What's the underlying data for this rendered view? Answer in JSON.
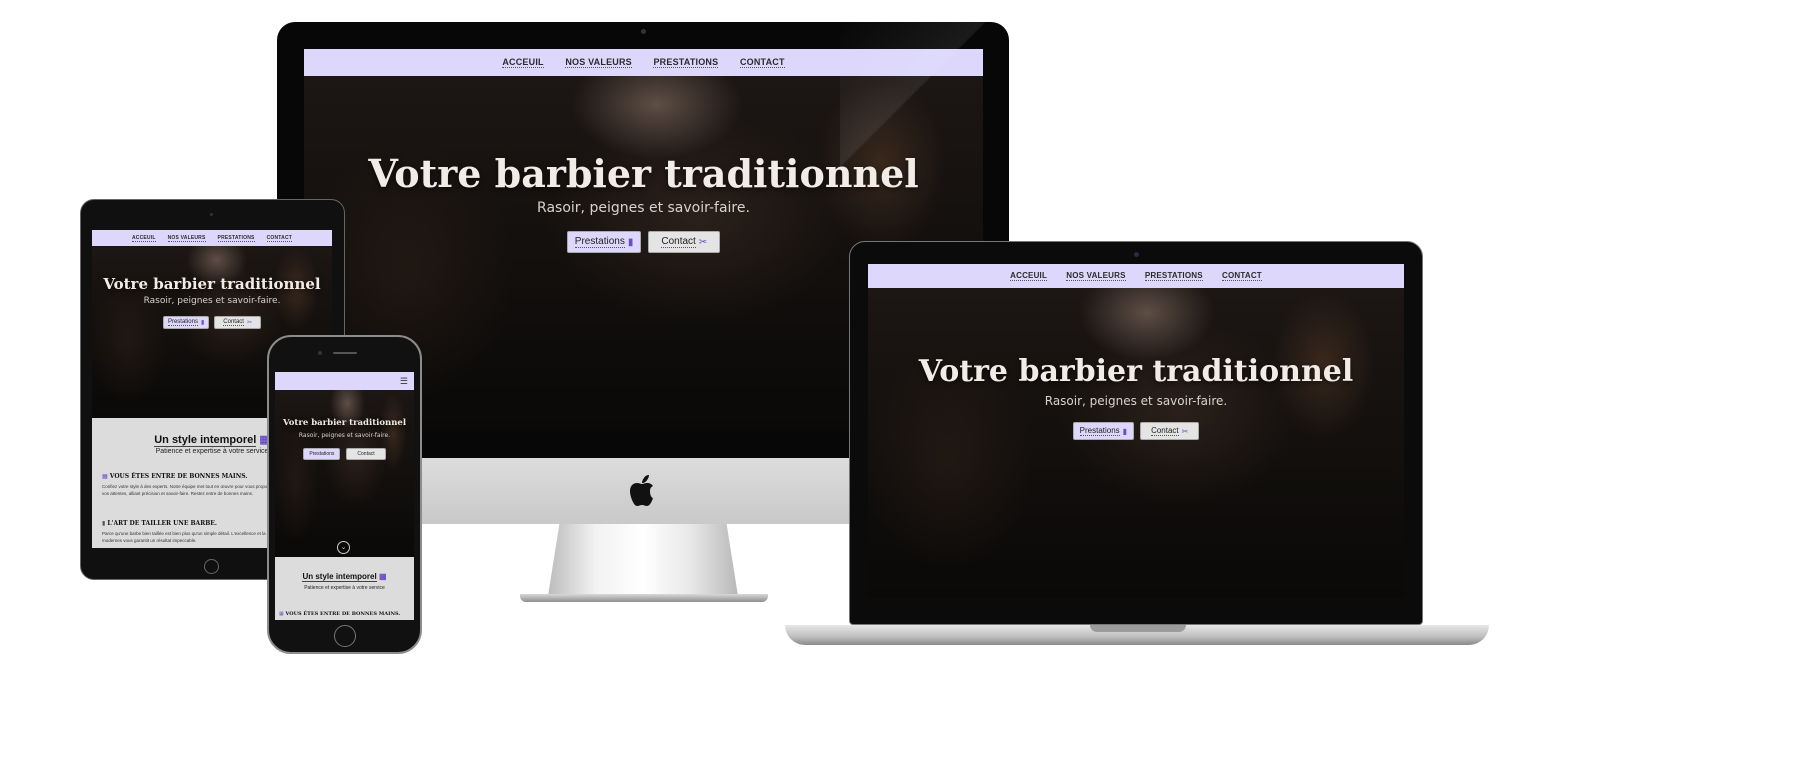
{
  "nav": {
    "items": [
      "ACCEUIL",
      "NOS VALEURS",
      "PRESTATIONS",
      "CONTACT"
    ]
  },
  "hero": {
    "title": "Votre barbier traditionnel",
    "subtitle": "Rasoir, peignes et savoir-faire.",
    "prestations_label": "Prestations",
    "contact_label": "Contact"
  },
  "section": {
    "title": "Un style intemporel",
    "subtitle": "Patience et expertise à votre service",
    "block1_title": "VOUS ÊTES ENTRE DE BONNES MAINS.",
    "block1_text": "Confiez votre style à des experts. Notre équipe met tout en œuvre pour vous proposer un service à la hauteur de vos attentes, alliant précision et savoir-faire. Restez entre de bonnes mains.",
    "block2_title": "L'ART DE TAILLER UNE BARBE.",
    "block2_text": "Parce qu'une barbe bien taillée est bien plus qu'un simple détail. L'excellence et la maîtrise des techniques modernes vous garantit un résultat impeccable."
  },
  "colors": {
    "nav_bg": "#dcd7fb",
    "hero_bg": "#120f0d",
    "section_bg": "#dcdcdc",
    "accent": "#6a4fc7"
  },
  "icons": [
    "apple-logo-icon",
    "hamburger-menu-icon",
    "scroll-down-icon",
    "comb-icon",
    "scissors-icon",
    "barber-chair-icon"
  ]
}
